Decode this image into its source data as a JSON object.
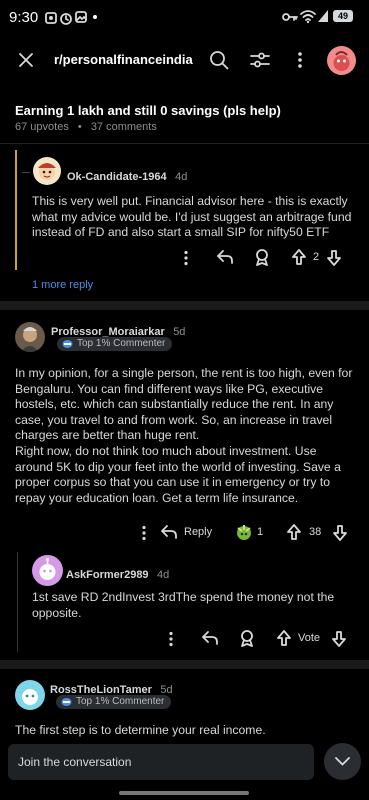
{
  "status": {
    "time": "9:30",
    "battery": "49"
  },
  "toolbar": {
    "subreddit": "r/personalfinanceindia"
  },
  "post": {
    "title": "Earning 1 lakh and still 0 savings (pls help)",
    "upvotes": "67 upvotes",
    "comments": "37 comments"
  },
  "comments": [
    {
      "username": "Ok-Candidate-1964",
      "age": "4d",
      "body": "This is very well put. Financial advisor here - this is exactly what my advice would be. I'd just suggest an arbitrage fund instead of FD and also start a small SIP for nifty50 ETF",
      "votes": "2",
      "more_replies": "1 more reply"
    },
    {
      "username": "Professor_Moraiarkar",
      "age": "5d",
      "badge": "Top 1% Commenter",
      "body_p1": "In my opinion, for a single person, the rent is too high, even for Bengaluru. You can find different ways like PG, executive hostels, etc. which can substantially reduce the rent. In any case, you travel to and from work. So, an increase in travel charges are better than huge rent.",
      "body_p2": "Right now, do not think too much about investment. Use around 5K to dip your feet into the world of investing. Save a proper corpus so that you can use it in emergency or try to repay your education loan. Get a term life insurance.",
      "reply_label": "Reply",
      "award_count": "1",
      "votes": "38"
    },
    {
      "username": "AskFormer2989",
      "age": "4d",
      "body": "1st save RD 2ndInvest 3rdThe spend the money not the opposite.",
      "vote_label": "Vote"
    },
    {
      "username": "RossTheLionTamer",
      "age": "5d",
      "badge": "Top 1% Commenter",
      "body": "The first step is to determine your real income."
    }
  ],
  "composer": {
    "placeholder": "Join the conversation"
  },
  "colors": {
    "accent_blue": "#4e8ee6",
    "thread_line_gold": "#c9a227",
    "background": "#000000"
  }
}
